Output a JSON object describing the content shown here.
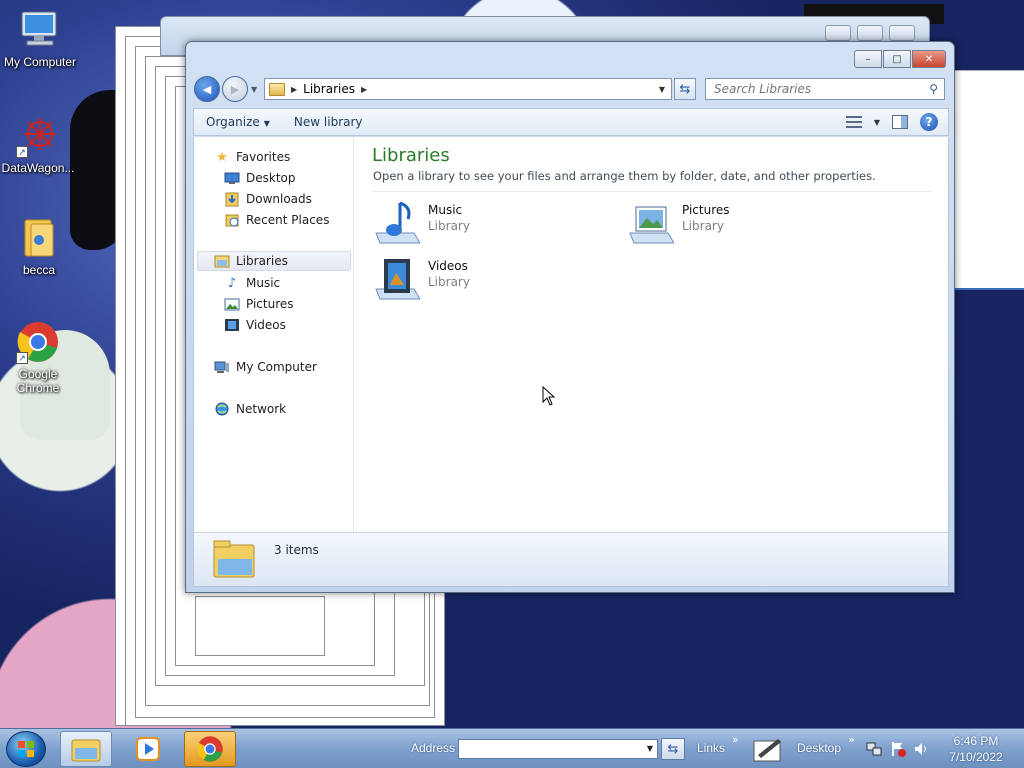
{
  "desktop": {
    "icons": [
      {
        "label": "My Computer",
        "icon": "computer-icon"
      },
      {
        "label": "DataWagon...",
        "icon": "datawagon-shortcut-icon"
      },
      {
        "label": "becca",
        "icon": "folder-icon"
      },
      {
        "label": "Google Chrome",
        "icon": "chrome-icon"
      }
    ]
  },
  "window": {
    "caption_buttons": {
      "minimize": "–",
      "maximize": "□",
      "close": "✕"
    },
    "nav": {
      "back_glyph": "◀",
      "forward_glyph": "▶",
      "breadcrumb": [
        "Libraries"
      ],
      "search_placeholder": "Search Libraries"
    },
    "command_bar": {
      "organize": "Organize",
      "new_library": "New library",
      "help": "?"
    },
    "nav_pane": {
      "favorites": {
        "label": "Favorites",
        "items": [
          "Desktop",
          "Downloads",
          "Recent Places"
        ]
      },
      "libraries": {
        "label": "Libraries",
        "items": [
          "Music",
          "Pictures",
          "Videos"
        ]
      },
      "computer": "My Computer",
      "network": "Network"
    },
    "main": {
      "title": "Libraries",
      "description": "Open a library to see your files and arrange them by folder, date, and other properties.",
      "items": [
        {
          "name": "Music",
          "type": "Library",
          "icon": "music-library-icon"
        },
        {
          "name": "Pictures",
          "type": "Library",
          "icon": "pictures-library-icon"
        },
        {
          "name": "Videos",
          "type": "Library",
          "icon": "videos-library-icon"
        }
      ]
    },
    "details": {
      "count": "3 items"
    }
  },
  "taskbar": {
    "address_label": "Address",
    "address_value": "",
    "links_label": "Links",
    "desktop_label": "Desktop",
    "chevron": "»",
    "clock": {
      "time": "6:46 PM",
      "date": "7/10/2022"
    }
  },
  "colors": {
    "library_title": "#2a7a2a",
    "taskbar": "#7fa1cd",
    "close_button": "#c6472f"
  }
}
